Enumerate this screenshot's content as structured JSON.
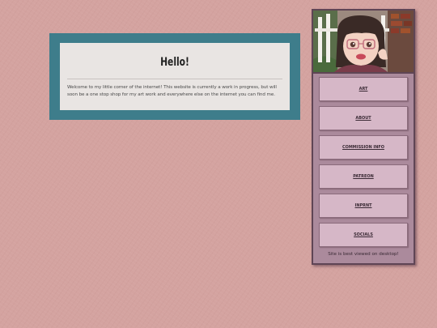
{
  "welcome": {
    "title": "Hello!",
    "body": "Welcome to my little corner of the internet! This website is currently a work in progress, but will soon be a one stop shop for my art work and everywhere else on the internet you can find me."
  },
  "sidebar": {
    "nav": [
      {
        "label": "ART"
      },
      {
        "label": "ABOUT"
      },
      {
        "label": "COMMISSION INFO"
      },
      {
        "label": "PATREON"
      },
      {
        "label": "INPRNT"
      },
      {
        "label": "SOCIALS"
      }
    ],
    "note": "Site is best viewed on desktop!"
  },
  "colors": {
    "background": "#d4a3a0",
    "panel_frame": "#3e7d8b",
    "card": "#e9e5e3",
    "sidebar": "#ab8a9c",
    "nav_button": "#d6b7c7"
  }
}
